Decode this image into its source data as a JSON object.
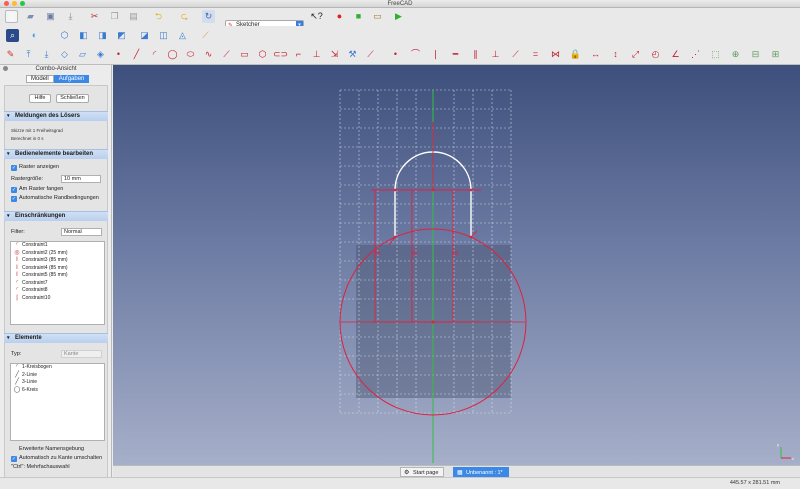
{
  "window": {
    "title": "FreeCAD",
    "mac_buttons": [
      "#fd5c55",
      "#fdbb2f",
      "#28c740"
    ]
  },
  "toolbar_top": {
    "workbench_selector": {
      "value": "Sketcher"
    },
    "icons": [
      "new-file-icon",
      "open-file-icon",
      "save-icon",
      "save-as-icon",
      "cut-icon",
      "copy-icon",
      "paste-icon",
      "undo-icon",
      "redo-icon",
      "refresh-icon",
      "workbench-icon",
      "whats-this-icon",
      "record-macro-icon",
      "stop-macro-icon",
      "edit-macro-icon",
      "run-macro-icon"
    ]
  },
  "left_panel": {
    "header": "Combo-Ansicht",
    "tabs": [
      {
        "label": "Modell",
        "active": false
      },
      {
        "label": "Aufgaben",
        "active": true
      }
    ],
    "buttons": {
      "help": "Hilfe",
      "close": "Schließen"
    },
    "solver": {
      "title": "Meldungen des Lösers",
      "line1": "Skizze mit 1 Freiheitsgrad",
      "line2": "Berechnet in 0 s"
    },
    "controls": {
      "title": "Bedienelemente bearbeiten",
      "show_grid": "Raster anzeigen",
      "grid_size_label": "Rastergröße:",
      "grid_size_value": "10 mm",
      "snap_grid": "Am Raster fangen",
      "auto_constraints": "Automatische Randbedingungen"
    },
    "constraints": {
      "title": "Einschränkungen",
      "filter_label": "Filter:",
      "filter_value": "Normal",
      "items": [
        {
          "label": "Constraint1",
          "icon": "tangent-icon"
        },
        {
          "label": "Constraint2 (25 mm)",
          "icon": "radius-icon"
        },
        {
          "label": "Constraint3 (85 mm)",
          "icon": "vertical-distance-icon"
        },
        {
          "label": "Constraint4 (85 mm)",
          "icon": "vertical-distance-icon"
        },
        {
          "label": "Constraint5 (85 mm)",
          "icon": "vertical-distance-icon"
        },
        {
          "label": "Constraint7",
          "icon": "tangent-icon"
        },
        {
          "label": "Constraint8",
          "icon": "tangent-icon"
        },
        {
          "label": "Constraint10",
          "icon": "vertical-icon"
        }
      ]
    },
    "elements": {
      "title": "Elemente",
      "type_label": "Typ:",
      "type_value": "Kante",
      "items": [
        {
          "label": "1-Kreisbogen",
          "icon": "arc-icon"
        },
        {
          "label": "2-Linie",
          "icon": "line-icon"
        },
        {
          "label": "3-Linie",
          "icon": "line-icon"
        },
        {
          "label": "6-Kreis",
          "icon": "circle-icon"
        }
      ],
      "extended_naming": "Erweiterte Namensgebung",
      "auto_switch": "Automatisch zu Kante umschalten",
      "multi_select_hint": "\"Ctrl\": Mehrfachauswahl"
    }
  },
  "bottom_tabs": [
    {
      "label": "Start page",
      "active": false
    },
    {
      "label": "Unbenannt : 1*",
      "active": true
    }
  ],
  "status": {
    "dimensions": "445.57 x 281.51 mm"
  },
  "colors": {
    "accent": "#3b88e6",
    "constraint_red": "#e02040",
    "selected_white": "#ffffff",
    "axis_green": "#30c040"
  }
}
